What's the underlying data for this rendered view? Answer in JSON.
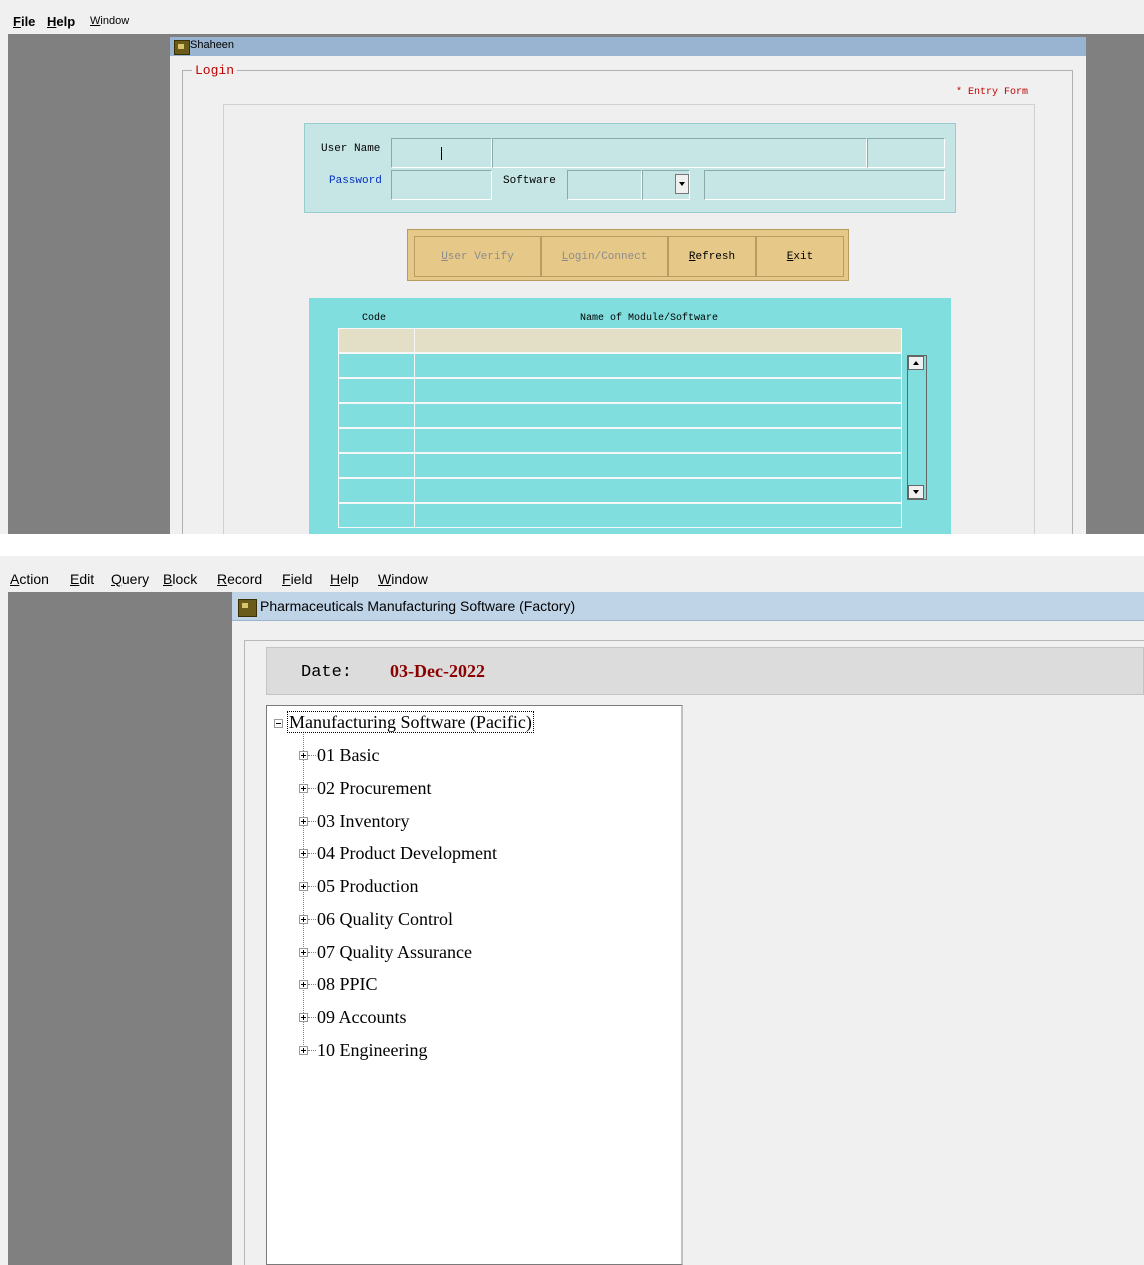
{
  "login_screen": {
    "menu": [
      {
        "id": "file",
        "label": "File",
        "ul": "F",
        "rest": "ile"
      },
      {
        "id": "help",
        "label": "Help",
        "ul": "H",
        "rest": "elp"
      },
      {
        "id": "window",
        "label": "Window",
        "ul": "W",
        "rest": "indow"
      }
    ],
    "window_title": "Shaheen",
    "form_title": "Login",
    "entry_form_label": "* Entry Form",
    "fields": {
      "user_name_label": "User Name",
      "password_label": "Password",
      "software_label": "Software"
    },
    "buttons": [
      {
        "id": "user-verify",
        "ul": "U",
        "rest": "ser Verify",
        "enabled": false
      },
      {
        "id": "login-connect",
        "ul": "L",
        "rest": "ogin/Connect",
        "enabled": false
      },
      {
        "id": "refresh",
        "ul": "R",
        "rest": "efresh",
        "enabled": true
      },
      {
        "id": "exit",
        "ul": "E",
        "rest": "xit",
        "enabled": true
      }
    ],
    "grid": {
      "col_code": "Code",
      "col_name": "Name of Module/Software",
      "rows": [
        {
          "code": "",
          "name": ""
        },
        {
          "code": "",
          "name": ""
        },
        {
          "code": "",
          "name": ""
        },
        {
          "code": "",
          "name": ""
        },
        {
          "code": "",
          "name": ""
        },
        {
          "code": "",
          "name": ""
        },
        {
          "code": "",
          "name": ""
        },
        {
          "code": "",
          "name": ""
        }
      ]
    }
  },
  "main_screen": {
    "menu": [
      {
        "id": "action",
        "ul": "A",
        "rest": "ction"
      },
      {
        "id": "edit",
        "ul": "E",
        "rest": "dit"
      },
      {
        "id": "query",
        "ul": "Q",
        "rest": "uery"
      },
      {
        "id": "block",
        "ul": "B",
        "rest": "lock"
      },
      {
        "id": "record",
        "ul": "R",
        "rest": "ecord"
      },
      {
        "id": "field",
        "ul": "F",
        "rest": "ield"
      },
      {
        "id": "help",
        "ul": "H",
        "rest": "elp"
      },
      {
        "id": "window",
        "ul": "W",
        "rest": "indow"
      }
    ],
    "window_title": "Pharmaceuticals Manufacturing Software (Factory)",
    "date_label": "Date:",
    "date_value": "03-Dec-2022",
    "tree": {
      "root": "Manufacturing Software (Pacific)",
      "items": [
        "01 Basic",
        "02 Procurement",
        "03 Inventory",
        "04 Product Development",
        "05 Production",
        "06 Quality Control",
        "07 Quality Assurance",
        "08 PPIC",
        "09 Accounts",
        "10 Engineering"
      ]
    }
  }
}
